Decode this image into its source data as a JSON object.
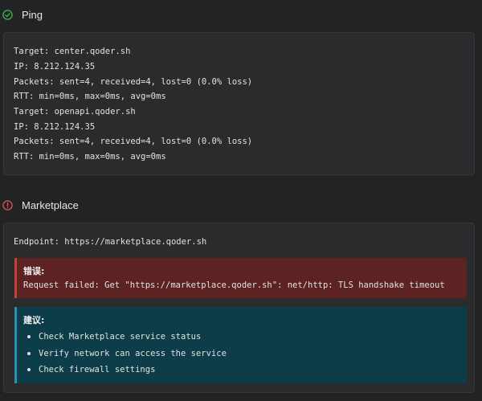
{
  "ping": {
    "title": "Ping",
    "status_color": "#3fb950",
    "lines": [
      "Target: center.qoder.sh",
      "IP: 8.212.124.35",
      "Packets: sent=4, received=4, lost=0 (0.0% loss)",
      "RTT: min=0ms, max=0ms, avg=0ms",
      "Target: openapi.qoder.sh",
      "IP: 8.212.124.35",
      "Packets: sent=4, received=4, lost=0 (0.0% loss)",
      "RTT: min=0ms, max=0ms, avg=0ms"
    ]
  },
  "marketplace": {
    "title": "Marketplace",
    "status_color": "#e5534b",
    "endpoint": "Endpoint: https://marketplace.qoder.sh",
    "error": {
      "title": "错误:",
      "message": "Request failed: Get \"https://marketplace.qoder.sh\": net/http: TLS handshake timeout",
      "bg_color": "#5c2322",
      "border_color": "#c4413c"
    },
    "suggestion": {
      "title": "建议:",
      "items": [
        "Check Marketplace service status",
        "Verify network can access the service",
        "Check firewall settings"
      ],
      "bg_color": "#0d3d48",
      "border_color": "#2d8fb0"
    }
  }
}
